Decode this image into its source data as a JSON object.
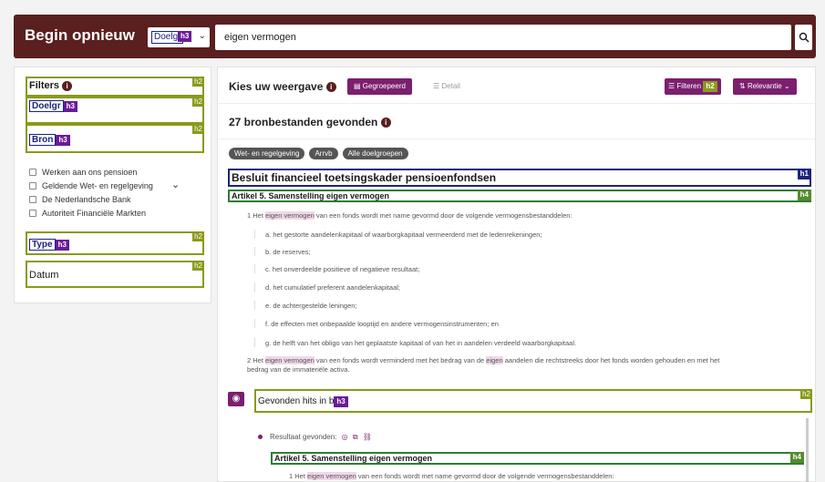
{
  "header": {
    "reset_label": "Begin opnieuw",
    "select_value": "Doelgr",
    "select_tag": "h3",
    "search_value": "eigen vermogen",
    "search_icon": "search-icon"
  },
  "filters": {
    "title": "Filters",
    "doelgroep": "Doelgr",
    "bron": "Bron",
    "type": "Type",
    "datum": "Datum",
    "h2": "h2",
    "h3": "h3",
    "options": [
      "Werken aan ons pensioen",
      "Geldende Wet- en regelgeving",
      "De Nederlandsche Bank",
      "Autoriteit Financiële Markten"
    ]
  },
  "toolbar": {
    "choose_label": "Kies uw weergave",
    "grouped_label": "Gegroepeerd",
    "detail_label": "Detail",
    "filter_label": "Filteren",
    "relevance_label": "Relevantie"
  },
  "results": {
    "count_text": "27 bronbestanden gevonden",
    "chips": [
      "Wet- en regelgeving",
      "Arrvb",
      "Alle doelgroepen"
    ],
    "doc_title": "Besluit financieel toetsingskader pensioenfondsen",
    "h1": "h1",
    "h4": "h4",
    "article_title": "Artikel 5. Samenstelling eigen vermogen",
    "para1_a": "1 Het",
    "para1_hl": "eigen vermogen",
    "para1_b": "van een fonds wordt met name gevormd door de volgende vermogensbestanddelen:",
    "items": [
      "a. het gestorte aandelenkapitaal of waarborgkapitaal vermeerderd met de ledenrekeningen;",
      "b. de reserves;",
      "c. het onverdeelde positieve of negatieve resultaat;",
      "d. het cumulatief preferent aandelenkapitaal;",
      "e. de achtergestelde leningen;",
      "f. de effecten met onbepaalde looptijd en andere vermogensinstrumenten; en",
      "g. de helft van het obligo van het geplaatste kapitaal of van het in aandelen verdeeld waarborgkapitaal."
    ],
    "para2_a": "2 Het",
    "para2_hl": "eigen vermogen",
    "para2_b": "van een fonds wordt verminderd met het bedrag van de",
    "para2_hl2": "eigen",
    "para2_c": "aandelen die rechtstreeks door het fonds worden gehouden en met het",
    "para2_d": "bedrag van de immateriële activa.",
    "hits_label": "Gevonden hits in b",
    "result_label": "Resultaat gevonden:",
    "article_title_2": "Artikel 5. Samenstelling eigen vermogen",
    "para3_a": "1 Het",
    "para3_hl": "eigen vermogen",
    "para3_b": "van een fonds wordt met name gevormd door de volgende vermogensbestanddelen:"
  }
}
